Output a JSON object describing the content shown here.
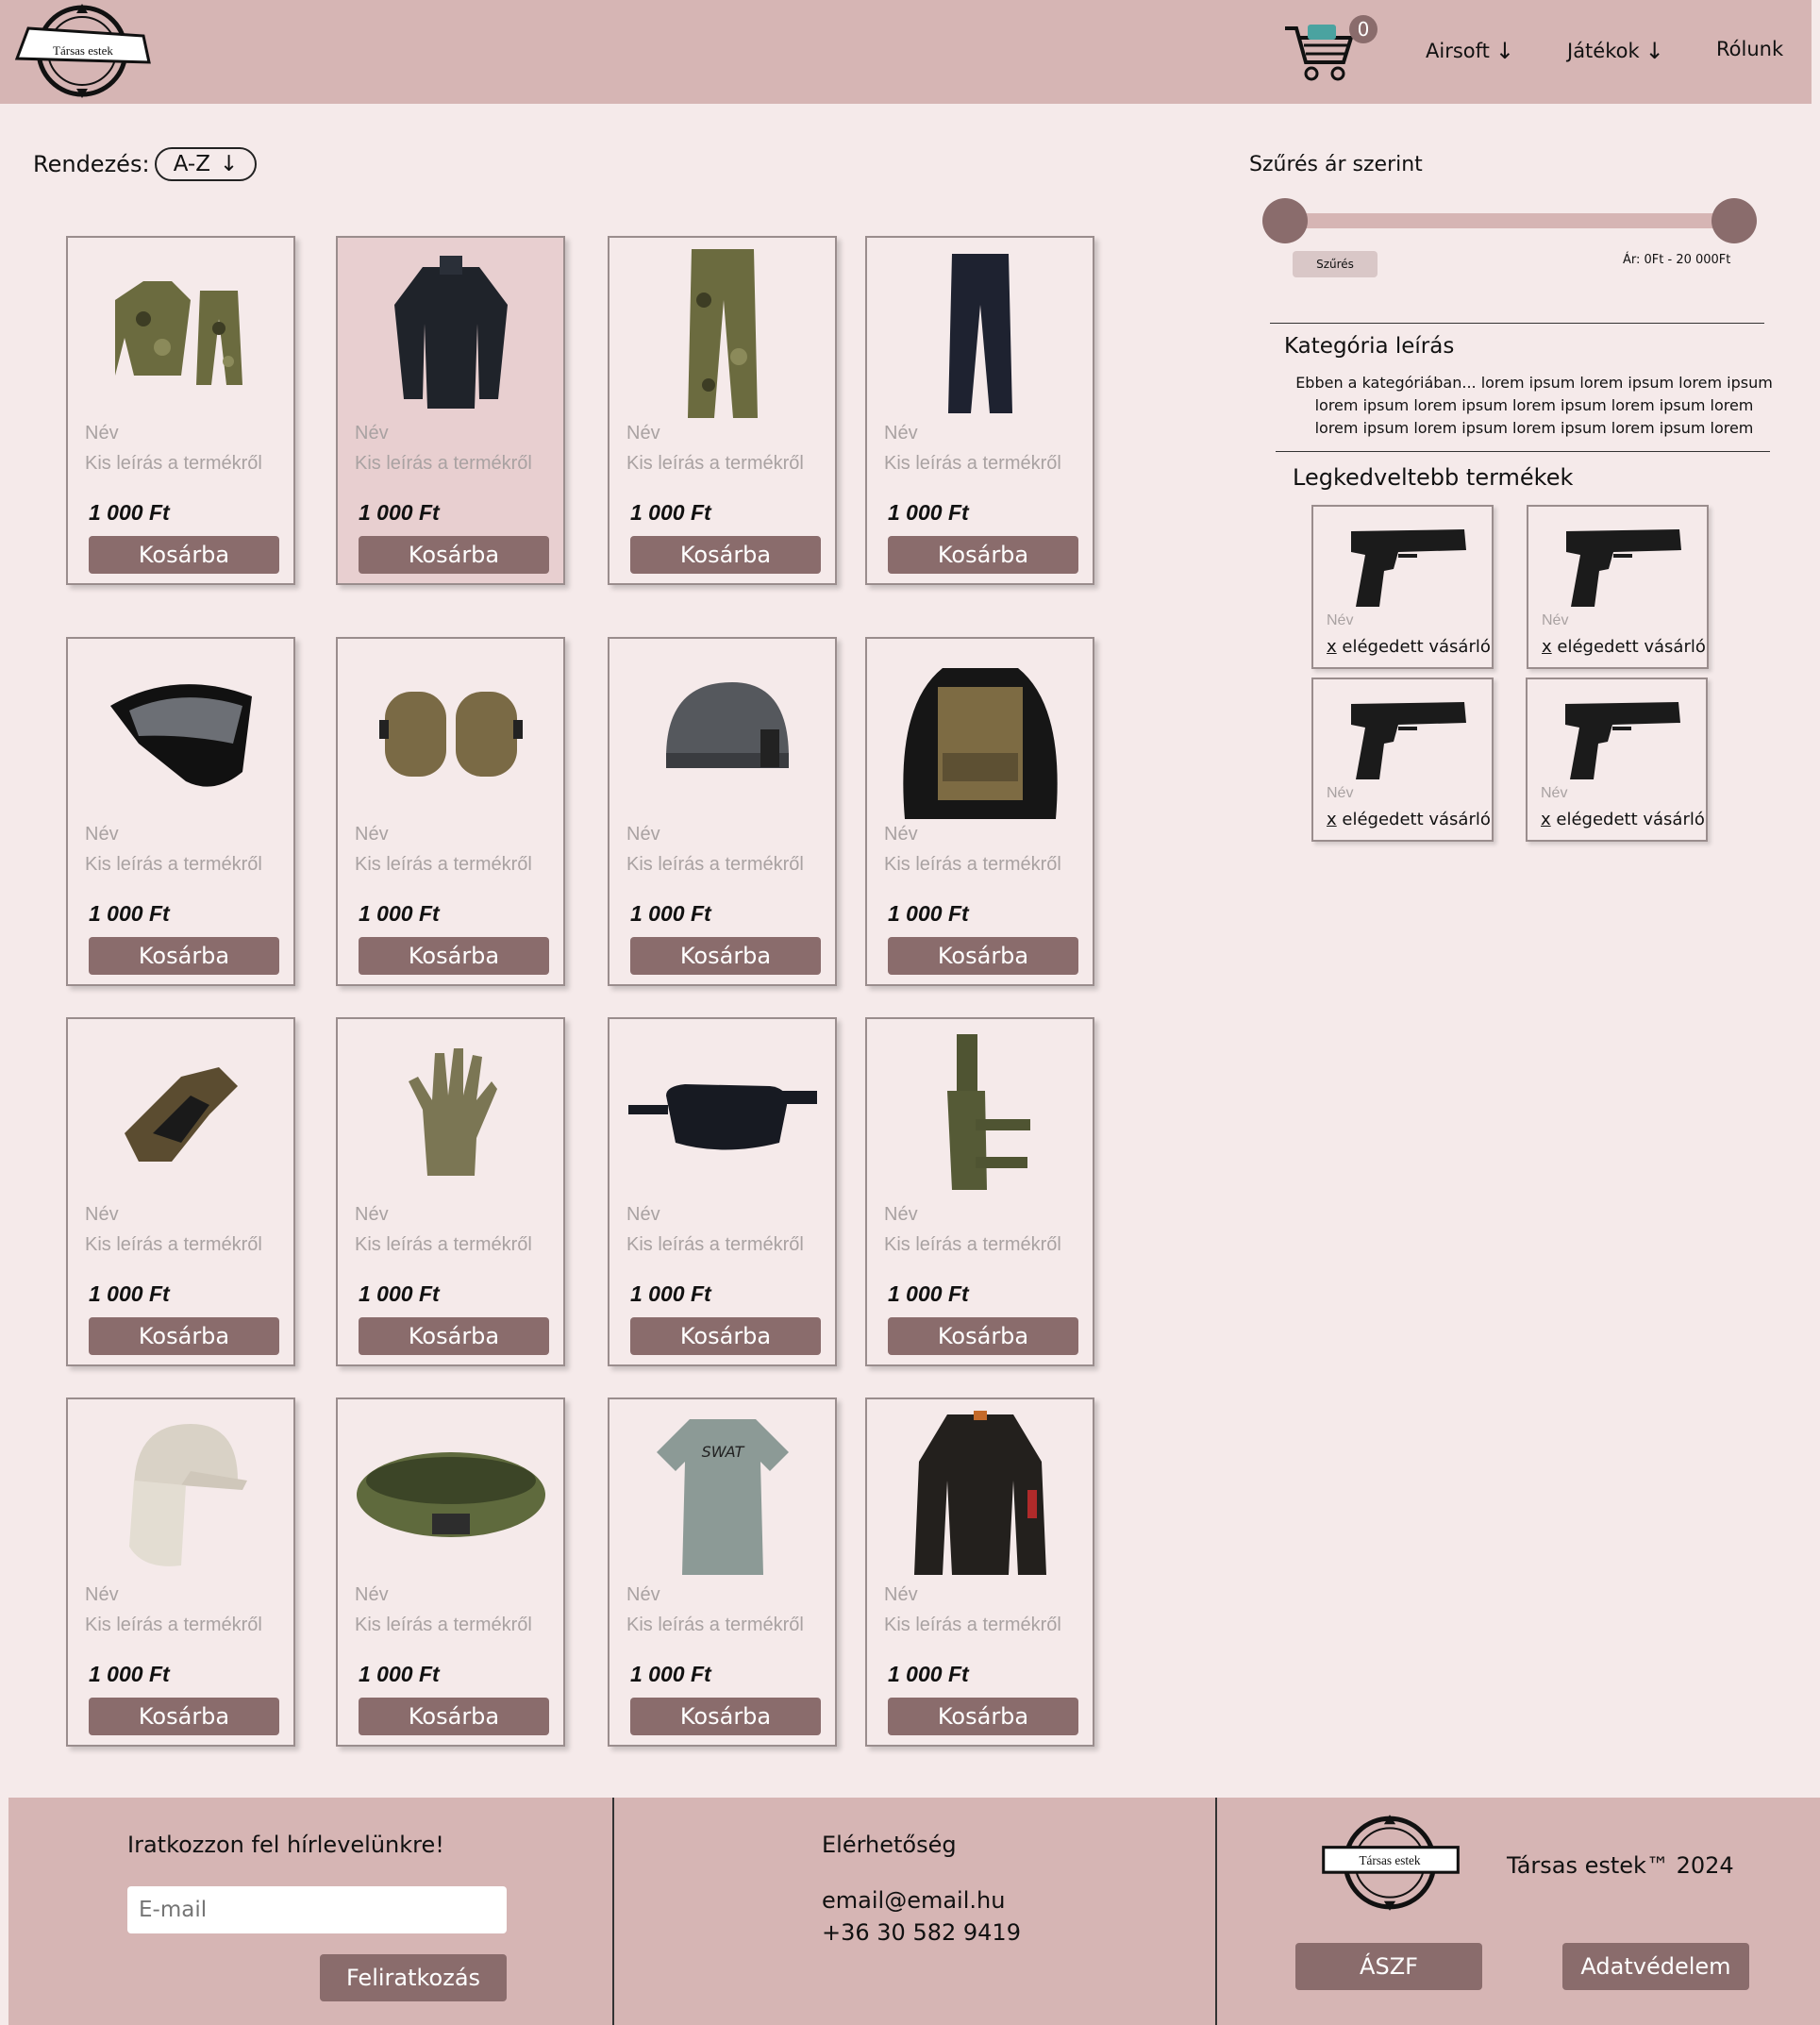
{
  "header": {
    "logo_text": "Társas estek",
    "cart_count": "0",
    "nav": [
      {
        "label": "Airsoft",
        "arrow": "↓"
      },
      {
        "label": "Játékok",
        "arrow": "↓"
      },
      {
        "label": "Rólunk",
        "arrow": ""
      }
    ]
  },
  "sort": {
    "label": "Rendezés:",
    "value": "A-Z",
    "arrow": "↓"
  },
  "products": [
    {
      "name": "Név",
      "desc": "Kis leírás a termékről",
      "price": "1 000 Ft",
      "button": "Kosárba",
      "icon": "camo-uniform-icon"
    },
    {
      "name": "Név",
      "desc": "Kis leírás a termékről",
      "price": "1 000 Ft",
      "button": "Kosárba",
      "icon": "black-combat-shirt-icon"
    },
    {
      "name": "Név",
      "desc": "Kis leírás a termékről",
      "price": "1 000 Ft",
      "button": "Kosárba",
      "icon": "camo-pants-icon"
    },
    {
      "name": "Név",
      "desc": "Kis leírás a termékről",
      "price": "1 000 Ft",
      "button": "Kosárba",
      "icon": "black-pants-icon"
    },
    {
      "name": "Név",
      "desc": "Kis leírás a termékről",
      "price": "1 000 Ft",
      "button": "Kosárba",
      "icon": "airsoft-mask-icon"
    },
    {
      "name": "Név",
      "desc": "Kis leírás a termékről",
      "price": "1 000 Ft",
      "button": "Kosárba",
      "icon": "knee-pads-icon"
    },
    {
      "name": "Név",
      "desc": "Kis leírás a termékről",
      "price": "1 000 Ft",
      "button": "Kosárba",
      "icon": "tactical-helmet-icon"
    },
    {
      "name": "Név",
      "desc": "Kis leírás a termékről",
      "price": "1 000 Ft",
      "button": "Kosárba",
      "icon": "plate-carrier-vest-icon"
    },
    {
      "name": "Név",
      "desc": "Kis leírás a termékről",
      "price": "1 000 Ft",
      "button": "Kosárba",
      "icon": "tactical-gloves-icon"
    },
    {
      "name": "Név",
      "desc": "Kis leírás a termékről",
      "price": "1 000 Ft",
      "button": "Kosárba",
      "icon": "camo-gloves-icon"
    },
    {
      "name": "Név",
      "desc": "Kis leírás a termékről",
      "price": "1 000 Ft",
      "button": "Kosárba",
      "icon": "waist-bag-icon"
    },
    {
      "name": "Név",
      "desc": "Kis leírás a termékről",
      "price": "1 000 Ft",
      "button": "Kosárba",
      "icon": "leg-holster-icon"
    },
    {
      "name": "Név",
      "desc": "Kis leírás a termékről",
      "price": "1 000 Ft",
      "button": "Kosárba",
      "icon": "sun-cap-icon"
    },
    {
      "name": "Név",
      "desc": "Kis leírás a termékről",
      "price": "1 000 Ft",
      "button": "Kosárba",
      "icon": "tactical-belt-icon"
    },
    {
      "name": "Név",
      "desc": "Kis leírás a termékről",
      "price": "1 000 Ft",
      "button": "Kosárba",
      "icon": "swat-tshirt-icon"
    },
    {
      "name": "Név",
      "desc": "Kis leírás a termékről",
      "price": "1 000 Ft",
      "button": "Kosárba",
      "icon": "bomber-jacket-icon"
    }
  ],
  "filter": {
    "title": "Szűrés ár szerint",
    "button": "Szűrés",
    "range_text": "Ár: 0Ft - 20 000Ft",
    "min": 0,
    "max": 20000
  },
  "category": {
    "title": "Kategória leírás",
    "description": "Ebben a kategóriában... lorem ipsum lorem ipsum lorem ipsum lorem ipsum lorem ipsum lorem ipsum lorem ipsum lorem lorem ipsum lorem ipsum lorem ipsum lorem ipsum lorem"
  },
  "favorites": {
    "title": "Legkedveltebb termékek",
    "items": [
      {
        "name": "Név",
        "sat_prefix": "x",
        "sat_text": " elégedett vásárló"
      },
      {
        "name": "Név",
        "sat_prefix": "x",
        "sat_text": " elégedett vásárló"
      },
      {
        "name": "Név",
        "sat_prefix": "x",
        "sat_text": " elégedett vásárló"
      },
      {
        "name": "Név",
        "sat_prefix": "x",
        "sat_text": " elégedett vásárló"
      }
    ]
  },
  "footer": {
    "newsletter_title": "Iratkozzon fel hírlevelünkre!",
    "email_placeholder": "E-mail",
    "subscribe_button": "Feliratkozás",
    "contact_title": "Elérhetőség",
    "contact_email": "email@email.hu",
    "contact_phone": "+36 30 582 9419",
    "brand": "Társas estek™ 2024",
    "logo_text": "Társas estek",
    "terms_button": "ÁSZF",
    "privacy_button": "Adatvédelem"
  },
  "colors": {
    "header_bg": "#d6b5b4",
    "page_bg": "#f5eaea",
    "button_bg": "#8a6c6c",
    "highlight_card": "#e8cfd0"
  }
}
